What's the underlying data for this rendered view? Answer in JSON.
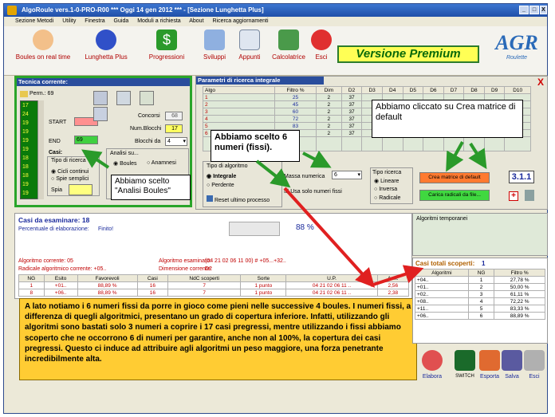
{
  "window": {
    "title": "AlgoRoule  vers.1-0-PRO-R00  ***  Oggi 14 gen 2012  ***  - [Sezione Lunghetta Plus]",
    "buttons": [
      "_",
      "□",
      "X"
    ]
  },
  "menu": [
    "Sezione Metodi",
    "Utility",
    "Finestra",
    "Guida",
    "Moduli a richiesta",
    "About",
    "Ricerca aggiornamenti"
  ],
  "toolbar": {
    "items": [
      "Boules on real time",
      "Lunghetta Plus",
      "Progressioni",
      "Sviluppi",
      "Appunti",
      "Calcolatrice",
      "Esci"
    ],
    "premium": "Versione Premium",
    "logo": "AGR",
    "logo_sub": "Roulette"
  },
  "tecnica": {
    "title": "Tecnica corrente:",
    "perm": "Perm.: 69",
    "list": [
      "17",
      "24",
      "19",
      "19",
      "19",
      "19",
      "18",
      "18",
      "18",
      "19",
      "19"
    ],
    "start_label": "START",
    "end_label": "END",
    "end_value": "69",
    "concorsi_label": "Concorsi",
    "concorsi_value": "68",
    "numblocchi_label": "Num.Blocchi",
    "numblocchi_value": "17",
    "blocchi_label": "Blocchi da",
    "blocchi_value": "4",
    "casi_label": "Casi:",
    "tipo_label": "Tipo di ricerca",
    "opt1": "Cicli continui",
    "opt2": "Spie semplici",
    "spia_label": "Spia",
    "analisi_label": "Analisi su...",
    "boules": "Boules",
    "anamnesi": "Anamnesi"
  },
  "params": {
    "title": "Parametri di ricerca integrale",
    "cols": [
      "Algo",
      "Filtro %",
      "Dim",
      "D2",
      "D3",
      "D4",
      "D5",
      "D6",
      "D7",
      "D8",
      "D9",
      "D10"
    ],
    "rows": [
      [
        "1",
        "25",
        "2",
        "37"
      ],
      [
        "2",
        "45",
        "2",
        "37"
      ],
      [
        "3",
        "60",
        "2",
        "37"
      ],
      [
        "4",
        "72",
        "2",
        "37"
      ],
      [
        "5",
        "83",
        "2",
        "37"
      ],
      [
        "6",
        "88",
        "2",
        "37"
      ]
    ],
    "tipo_algo": "Tipo di algoritmo",
    "integrale": "Integrale",
    "perdente": "Perdente",
    "massa": "Massa numerica",
    "massa_val": "6",
    "usa_fissi": "Usa solo numeri fissi",
    "reset": "Reset ultimo processo",
    "tipo_ricerca": "Tipo ricerca",
    "lineare": "Lineare",
    "inversa": "Inversa",
    "radicale": "Radicale",
    "crea_btn": "Crea matrice di default",
    "carica_btn": "Carica radicali da file...",
    "version": "3.1.1"
  },
  "callouts": {
    "c1": "Abbiamo cliccato su Crea matrice di default",
    "c2": "Abbiamo scelto 6 numeri (fissi).",
    "c3": "Abbiamo scelto \"Analisi Boules\""
  },
  "casi": {
    "title": "Casi da esaminare: 18",
    "percent_label": "Percentuale di elaborazione:",
    "finito": "Finito!",
    "percent": "88 %",
    "algo_corr": "Algoritmo corrente: 05",
    "algo_esam": "Algoritmo esaminato:",
    "algo_esam_val": "(04 21 02 06 11 00) # +05...+32..",
    "radicale": "Radicale algoritmico corrente: +05..",
    "dimensione": "Dimensione corrente:",
    "dimensione_val": "D2",
    "cols": [
      "NG",
      "Esito",
      "Favorevoli",
      "Casi",
      "NdC scoperti",
      "Sorte",
      "U.P.",
      "A.m."
    ],
    "rows": [
      [
        "1",
        "+01..",
        "88,89 %",
        "16",
        "7",
        "1 punto",
        "04 21 02 06 11 ..",
        "2,56"
      ],
      [
        "8",
        "+06..",
        "88,89 %",
        "16",
        "7",
        "1 punto",
        "04 21 02 06 11 ..",
        "2,38"
      ]
    ]
  },
  "yellow": "A lato notiamo i 6 numeri fissi da porre in gioco come pieni nelle successive 4 boules. I numeri fissi, a differenza di quegli algoritmici, presentano un grado di copertura inferiore. Infatti, utilizzando gli algoritmi sono bastati solo 3 numeri a coprire i 17 casi pregressi, mentre utilizzando i fissi abbiamo scoperto che ne occorrono 6 di numeri per garantire, anche non al 100%, la copertura dei casi pregressi. Questo ci induce ad attribuire agli algoritmi un peso maggiore, una forza penetrante incredibilmente alta.",
  "right": {
    "temp_title": "Algoritmi temporanei",
    "scoperti_label": "Casi totali scoperti:",
    "scoperti_val": "1",
    "cols": [
      "Algoritmi",
      "NG",
      "Filtro %"
    ],
    "rows": [
      [
        "+04..",
        "1",
        "27,78 %"
      ],
      [
        "+01..",
        "2",
        "50,00 %"
      ],
      [
        "+02..",
        "3",
        "61,11 %"
      ],
      [
        "+08..",
        "4",
        "72,22 %"
      ],
      [
        "+11..",
        "5",
        "83,33 %"
      ],
      [
        "+06..",
        "6",
        "88,89 %"
      ]
    ]
  },
  "bottom_icons": [
    "Elabora",
    "SWITCH",
    "Esporta",
    "Salva",
    "Esci"
  ],
  "colors": {
    "accent_green": "#2aa52a",
    "arrow_red": "#e02020",
    "arrow_green": "#2a9a2a",
    "yellow": "#ffcc33"
  }
}
